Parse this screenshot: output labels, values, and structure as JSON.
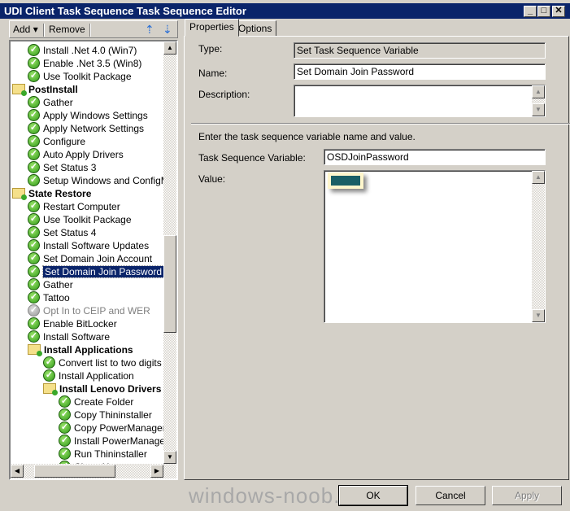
{
  "window": {
    "title": "UDI Client Task Sequence Task Sequence Editor",
    "controls": [
      "minimize",
      "maximize",
      "close"
    ]
  },
  "toolbar": {
    "add_label": "Add",
    "remove_label": "Remove",
    "icons": [
      "move-up-icon",
      "move-down-icon"
    ]
  },
  "tree": {
    "items": [
      {
        "label": "Install .Net 4.0 (Win7)",
        "level": 1,
        "type": "step"
      },
      {
        "label": "Enable .Net 3.5 (Win8)",
        "level": 1,
        "type": "step"
      },
      {
        "label": "Use Toolkit Package",
        "level": 1,
        "type": "step"
      },
      {
        "label": "PostInstall",
        "level": 0,
        "type": "group"
      },
      {
        "label": "Gather",
        "level": 1,
        "type": "step"
      },
      {
        "label": "Apply Windows Settings",
        "level": 1,
        "type": "step"
      },
      {
        "label": "Apply Network Settings",
        "level": 1,
        "type": "step"
      },
      {
        "label": "Configure",
        "level": 1,
        "type": "step"
      },
      {
        "label": "Auto Apply Drivers",
        "level": 1,
        "type": "step"
      },
      {
        "label": "Set Status 3",
        "level": 1,
        "type": "step"
      },
      {
        "label": "Setup Windows and ConfigMgr",
        "level": 1,
        "type": "step"
      },
      {
        "label": "State Restore",
        "level": 0,
        "type": "group"
      },
      {
        "label": "Restart Computer",
        "level": 1,
        "type": "step"
      },
      {
        "label": "Use Toolkit Package",
        "level": 1,
        "type": "step"
      },
      {
        "label": "Set Status 4",
        "level": 1,
        "type": "step"
      },
      {
        "label": "Install Software Updates",
        "level": 1,
        "type": "step"
      },
      {
        "label": "Set Domain Join Account",
        "level": 1,
        "type": "step"
      },
      {
        "label": "Set Domain Join Password",
        "level": 1,
        "type": "step",
        "selected": true
      },
      {
        "label": "Gather",
        "level": 1,
        "type": "step"
      },
      {
        "label": "Tattoo",
        "level": 1,
        "type": "step"
      },
      {
        "label": "Opt In to CEIP and WER",
        "level": 1,
        "type": "step",
        "disabled": true
      },
      {
        "label": "Enable BitLocker",
        "level": 1,
        "type": "step"
      },
      {
        "label": "Install Software",
        "level": 1,
        "type": "step"
      },
      {
        "label": "Install Applications",
        "level": 1,
        "type": "group"
      },
      {
        "label": "Convert list to two digits",
        "level": 2,
        "type": "step"
      },
      {
        "label": "Install Application",
        "level": 2,
        "type": "step"
      },
      {
        "label": "Install Lenovo Drivers",
        "level": 2,
        "type": "group"
      },
      {
        "label": "Create Folder",
        "level": 3,
        "type": "step"
      },
      {
        "label": "Copy Thininstaller",
        "level": 3,
        "type": "step"
      },
      {
        "label": "Copy PowerManager",
        "level": 3,
        "type": "step"
      },
      {
        "label": "Install PowerManager",
        "level": 3,
        "type": "step"
      },
      {
        "label": "Run Thininstaller",
        "level": 3,
        "type": "step"
      },
      {
        "label": "Clean Up",
        "level": 3,
        "type": "step"
      }
    ]
  },
  "tabs": [
    {
      "label": "Properties",
      "active": true
    },
    {
      "label": "Options"
    }
  ],
  "properties": {
    "type_label": "Type:",
    "type_value": "Set Task Sequence Variable",
    "name_label": "Name:",
    "name_value": "Set Domain Join Password",
    "description_label": "Description:",
    "description_value": "",
    "instruction": "Enter the task sequence variable name and value.",
    "variable_label": "Task Sequence Variable:",
    "variable_value": "OSDJoinPassword",
    "value_label": "Value:",
    "redaction_color": "#1a5f66"
  },
  "buttons": {
    "ok": "OK",
    "cancel": "Cancel",
    "apply": "Apply"
  },
  "watermark": "windows-noob.com",
  "colors": {
    "titlebar": "#0a246a",
    "selection": "#0a246a",
    "face": "#d4d0c8"
  }
}
